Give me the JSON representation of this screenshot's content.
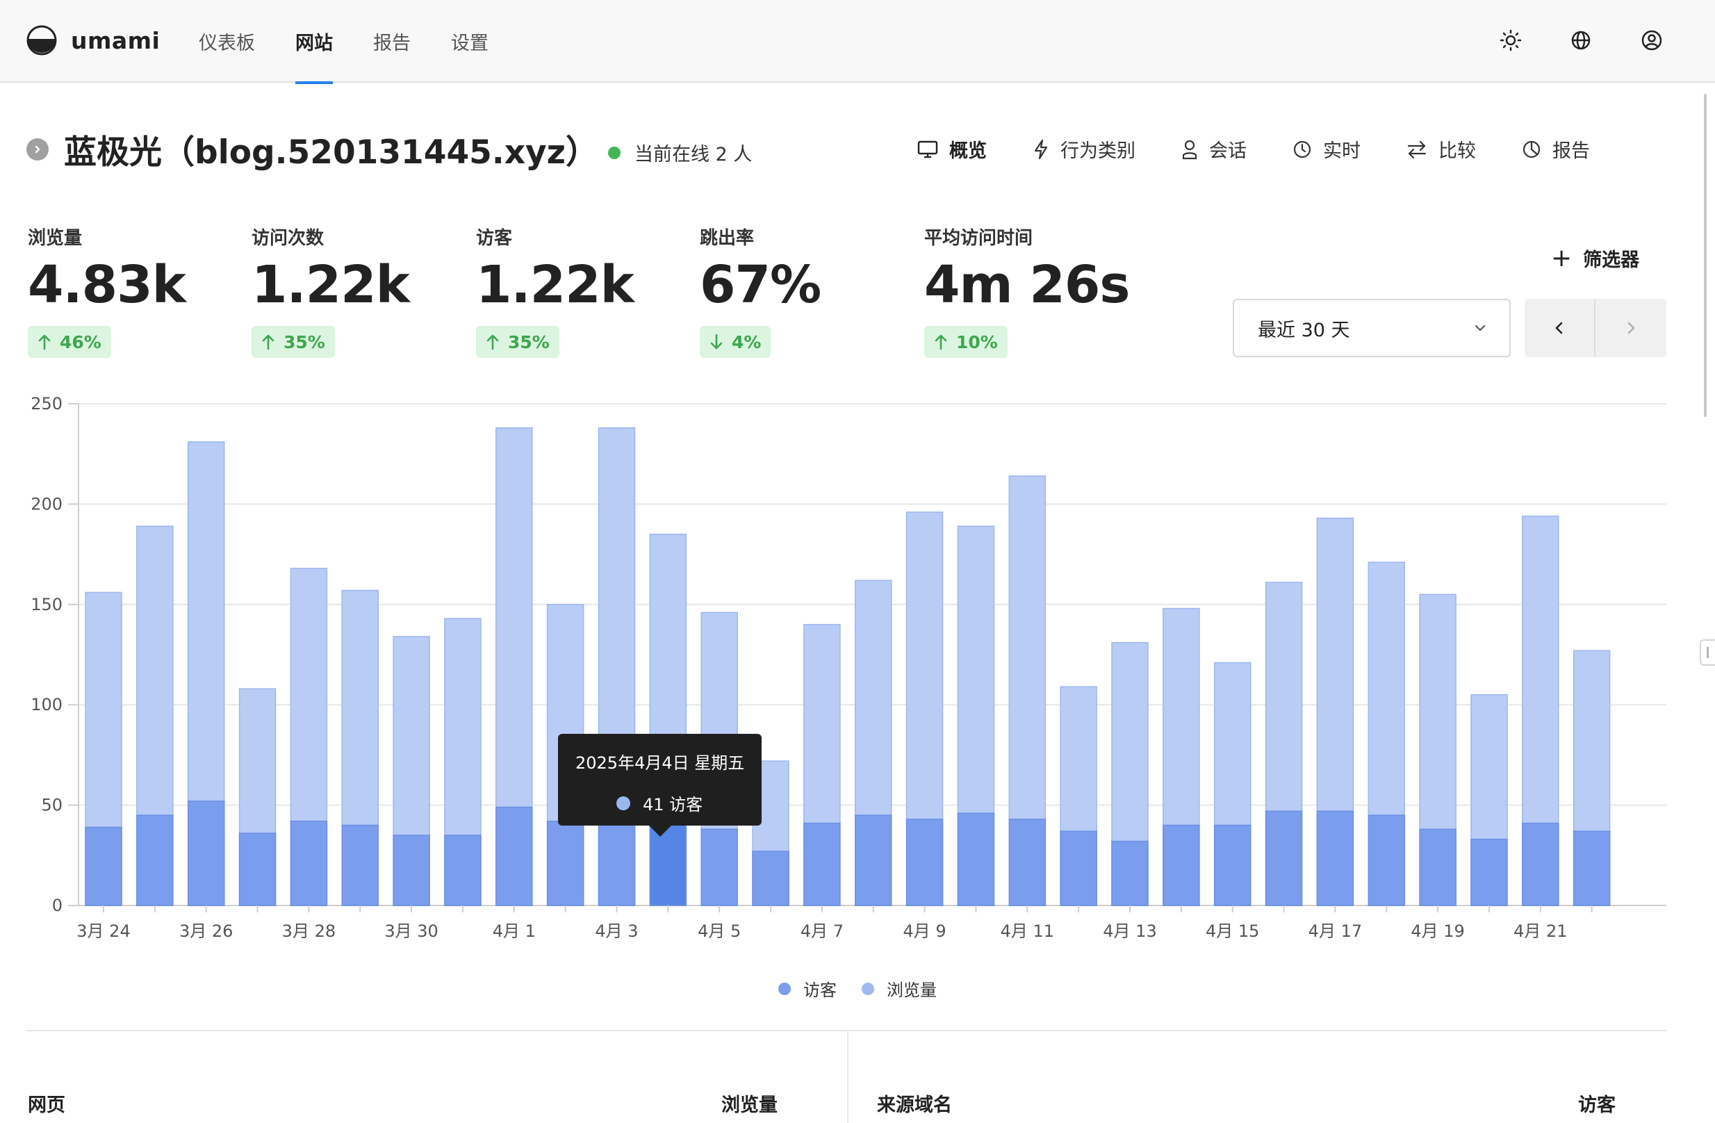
{
  "app": {
    "name": "umami"
  },
  "nav": {
    "items": [
      {
        "label": "仪表板",
        "active": false
      },
      {
        "label": "网站",
        "active": true
      },
      {
        "label": "报告",
        "active": false
      },
      {
        "label": "设置",
        "active": false
      }
    ]
  },
  "header_actions": [
    "theme-toggle",
    "language",
    "profile"
  ],
  "site": {
    "title": "蓝极光（blog.520131445.xyz）",
    "online_text": "当前在线 2 人"
  },
  "tabs": [
    {
      "label": "概览",
      "icon": "monitor-icon",
      "active": true
    },
    {
      "label": "行为类别",
      "icon": "lightning-icon",
      "active": false
    },
    {
      "label": "会话",
      "icon": "user-icon",
      "active": false
    },
    {
      "label": "实时",
      "icon": "clock-icon",
      "active": false
    },
    {
      "label": "比较",
      "icon": "swap-icon",
      "active": false
    },
    {
      "label": "报告",
      "icon": "pie-icon",
      "active": false
    }
  ],
  "metrics": [
    {
      "label": "浏览量",
      "value": "4.83k",
      "change": "46%",
      "direction": "up"
    },
    {
      "label": "访问次数",
      "value": "1.22k",
      "change": "35%",
      "direction": "up"
    },
    {
      "label": "访客",
      "value": "1.22k",
      "change": "35%",
      "direction": "up"
    },
    {
      "label": "跳出率",
      "value": "67%",
      "change": "4%",
      "direction": "down"
    },
    {
      "label": "平均访问时间",
      "value": "4m 26s",
      "change": "10%",
      "direction": "up"
    }
  ],
  "filter": {
    "label": "筛选器"
  },
  "date_range": {
    "selected": "最近 30 天"
  },
  "colors": {
    "accent": "#2680eb",
    "visitors": "#7a9ded",
    "pageviews": "#b8ccf5",
    "visitors_highlight": "#5585e6",
    "positive": "#3ea64f",
    "positive_bg": "#dcf5e0"
  },
  "chart_data": {
    "type": "bar",
    "stacked": true,
    "ylim": [
      0,
      250
    ],
    "yticks": [
      0,
      50,
      100,
      150,
      200,
      250
    ],
    "categories": [
      "3月 24",
      "3月 25",
      "3月 26",
      "3月 27",
      "3月 28",
      "3月 29",
      "3月 30",
      "3月 31",
      "4月 1",
      "4月 2",
      "4月 3",
      "4月 4",
      "4月 5",
      "4月 6",
      "4月 7",
      "4月 8",
      "4月 9",
      "4月 10",
      "4月 11",
      "4月 12",
      "4月 13",
      "4月 14",
      "4月 15",
      "4月 16",
      "4月 17",
      "4月 18",
      "4月 19",
      "4月 20",
      "4月 21",
      "4月 22"
    ],
    "xtick_labels": [
      "3月 24",
      "3月 26",
      "3月 28",
      "3月 30",
      "4月 1",
      "4月 3",
      "4月 5",
      "4月 7",
      "4月 9",
      "4月 11",
      "4月 13",
      "4月 15",
      "4月 17",
      "4月 19",
      "4月 21"
    ],
    "series": [
      {
        "name": "访客",
        "values": [
          39,
          45,
          52,
          36,
          42,
          40,
          35,
          35,
          49,
          42,
          49,
          41,
          38,
          27,
          41,
          45,
          43,
          46,
          43,
          37,
          32,
          40,
          40,
          47,
          47,
          45,
          38,
          33,
          41,
          37
        ]
      },
      {
        "name": "浏览量",
        "values": [
          156,
          189,
          231,
          108,
          168,
          157,
          134,
          143,
          238,
          150,
          238,
          185,
          146,
          72,
          140,
          162,
          196,
          189,
          214,
          109,
          131,
          148,
          121,
          161,
          193,
          171,
          155,
          105,
          194,
          127
        ]
      }
    ],
    "grid": true,
    "legend": "bottom-center",
    "highlighted_index": 11,
    "tooltip": {
      "date": "2025年4月4日 星期五",
      "value_text": "41 访客"
    }
  },
  "tables": [
    {
      "title": "网页",
      "metric": "浏览量"
    },
    {
      "title": "来源域名",
      "metric": "访客"
    }
  ]
}
